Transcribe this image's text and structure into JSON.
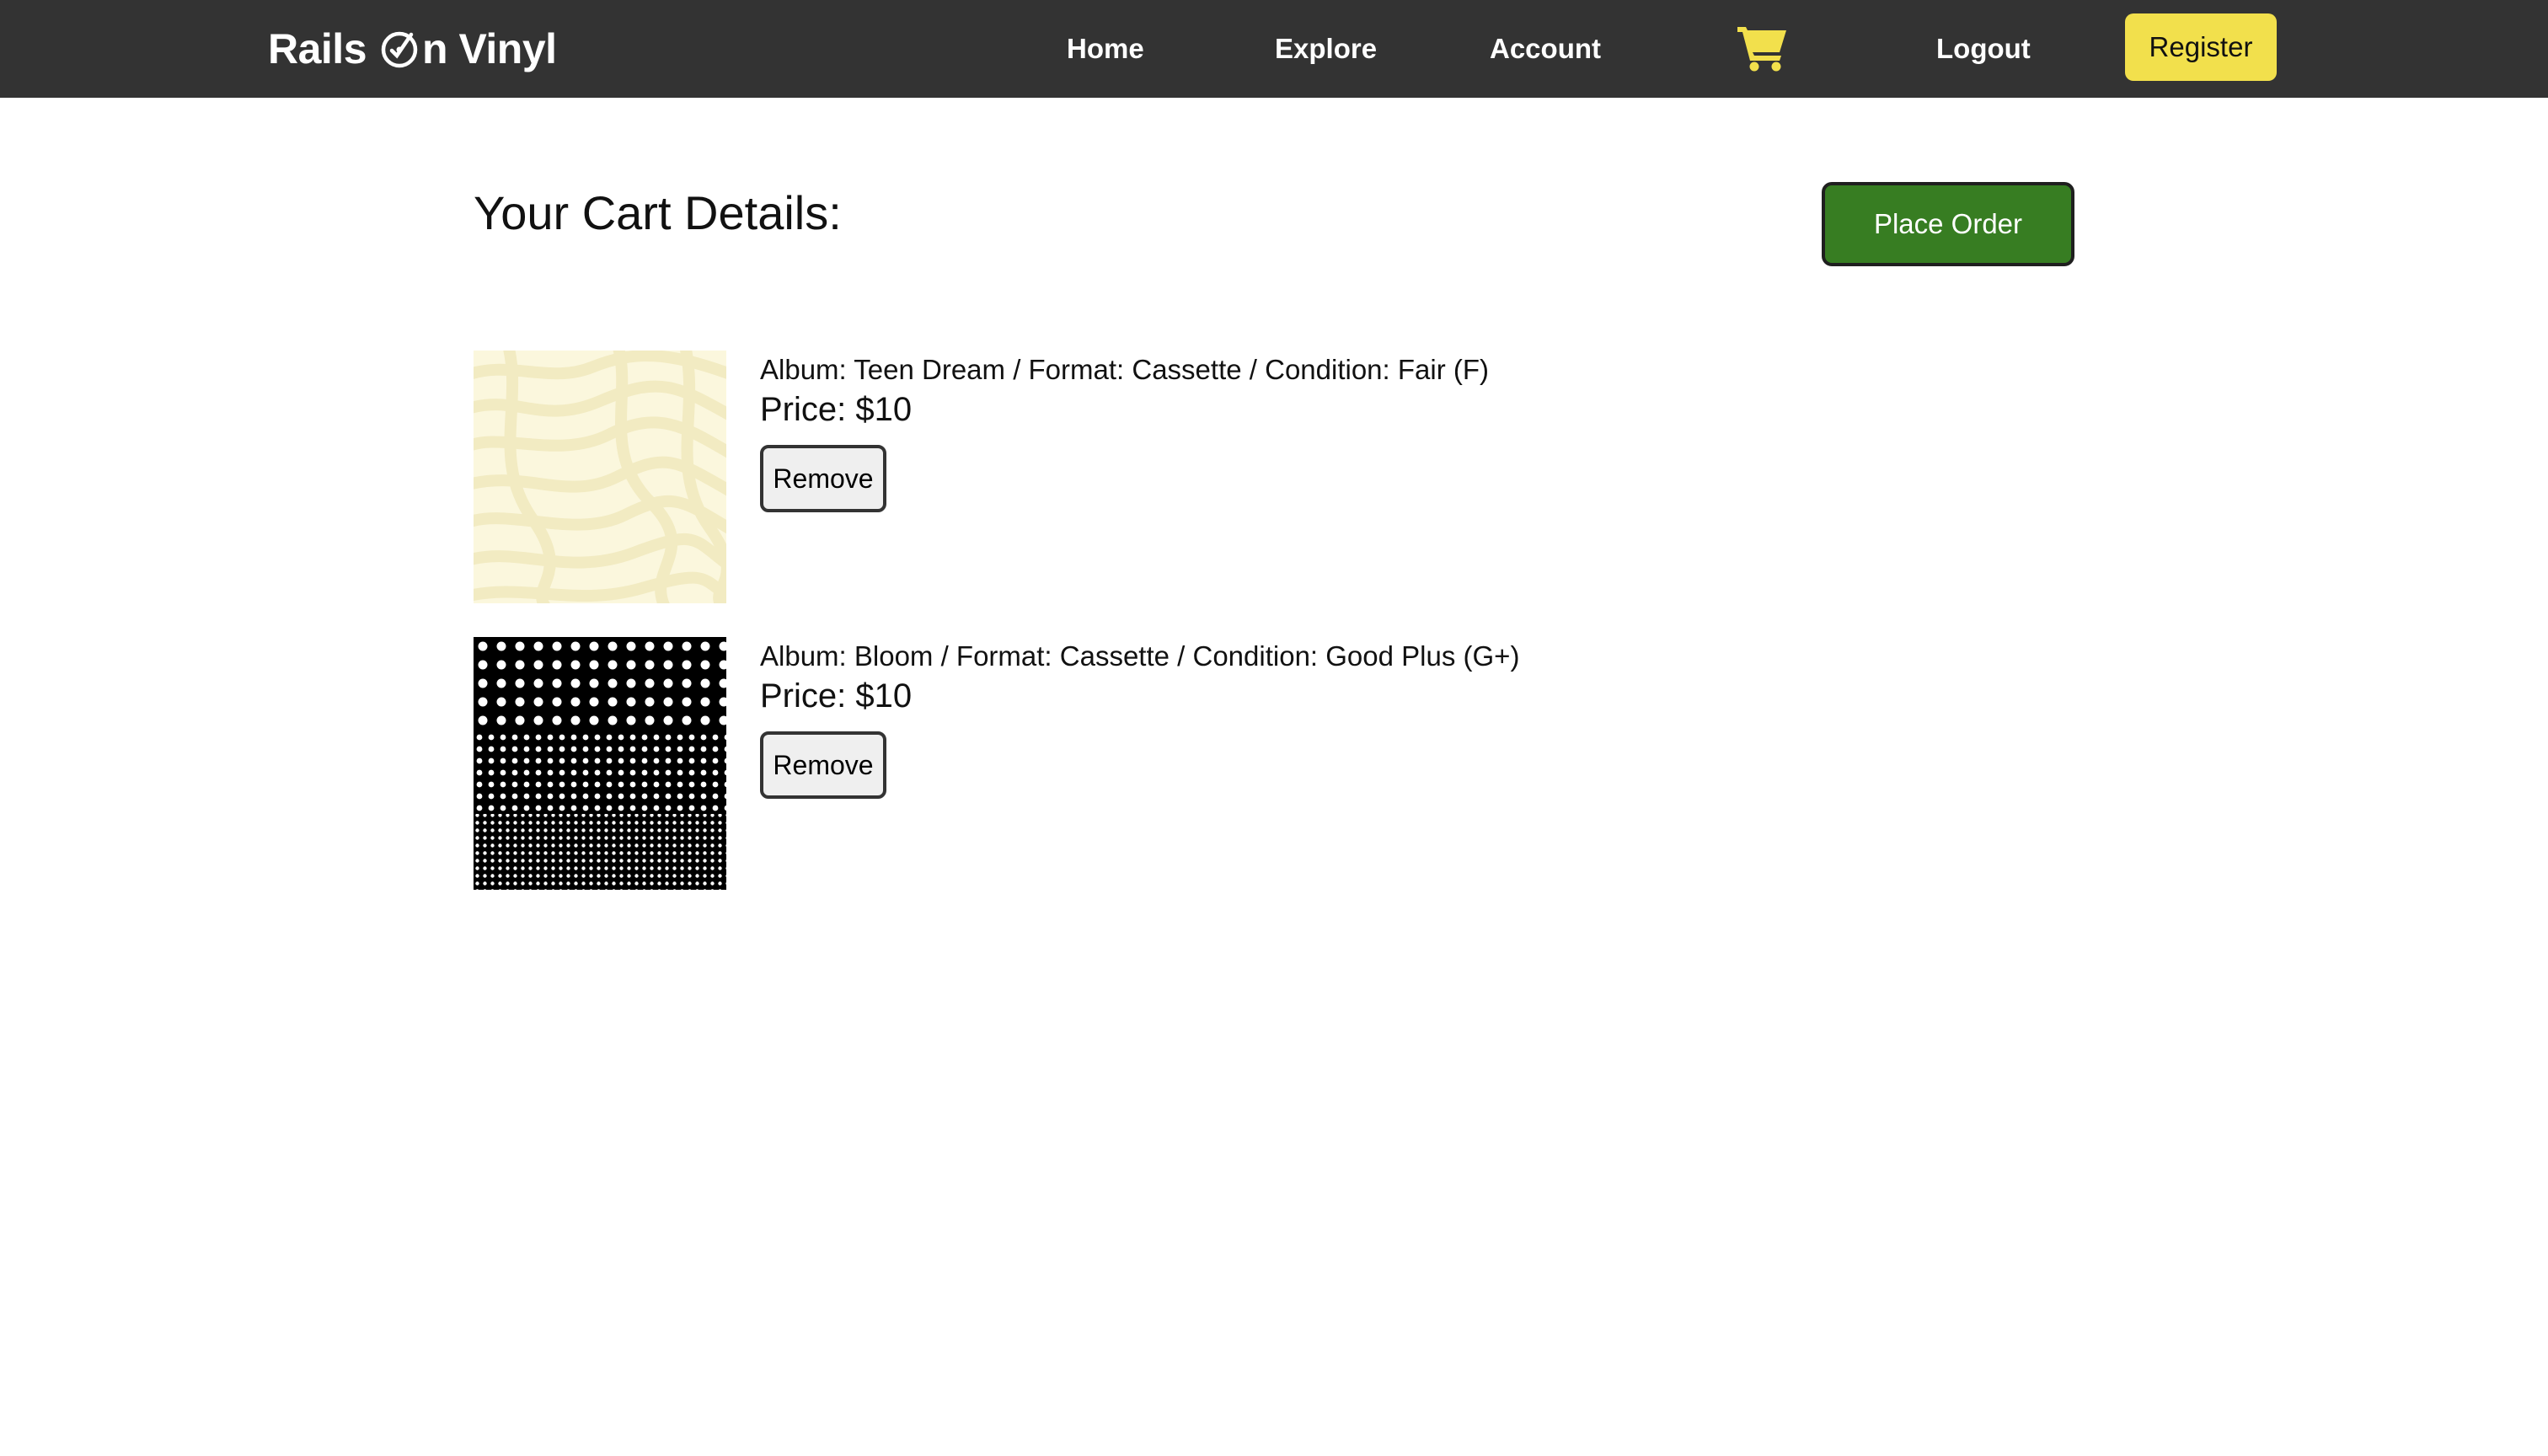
{
  "nav": {
    "brand_prefix": "Rails",
    "brand_suffix": "n Vinyl",
    "links": {
      "home": "Home",
      "explore": "Explore",
      "account": "Account",
      "logout": "Logout"
    },
    "register_label": "Register",
    "cart_icon": "shopping-cart-icon",
    "colors": {
      "bar": "#333333",
      "accent": "#f2e04c"
    }
  },
  "main": {
    "title": "Your Cart Details:",
    "place_order_label": "Place Order",
    "place_order_color": "#377d22"
  },
  "cart_items": [
    {
      "description": "Album: Teen Dream / Format: Cassette / Condition: Fair (F)",
      "price": "Price: $10",
      "remove_label": "Remove"
    },
    {
      "description": "Album: Bloom / Format: Cassette / Condition: Good Plus (G+)",
      "price": "Price: $10",
      "remove_label": "Remove"
    }
  ]
}
